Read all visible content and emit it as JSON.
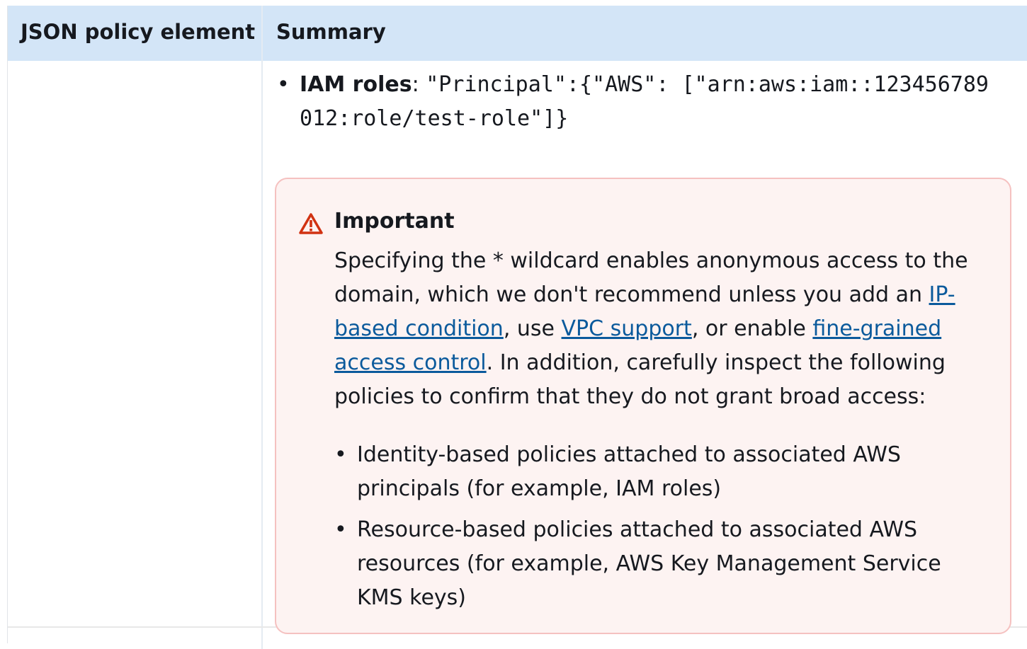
{
  "table": {
    "headers": [
      "JSON policy element",
      "Summary"
    ]
  },
  "bullet": {
    "label": "IAM roles",
    "separator": ": ",
    "code": "\"Principal\":{\"AWS\": [\"arn:aws:iam::123456789012:role/test-role\"]}"
  },
  "alert": {
    "title": "Important",
    "icon": "warning-triangle-icon",
    "text_1": "Specifying the * wildcard enables anonymous access to the domain, which we don't recommend unless you add an ",
    "link_1": "IP-based condition",
    "text_2": ", use ",
    "link_2": "VPC support",
    "text_3": ", or enable ",
    "link_3": "fine-grained access control",
    "text_4": ". In addition, carefully inspect the following policies to confirm that they do not grant broad access:",
    "items": [
      "Identity-based policies attached to associated AWS principals (for example, IAM roles)",
      "Resource-based policies attached to associated AWS resources (for example, AWS Key Management Service KMS keys)"
    ]
  },
  "colors": {
    "header_bg": "#d3e5f7",
    "alert_bg": "#fdf3f2",
    "alert_border": "#f5c1c0",
    "link": "#0b5a9c",
    "warning": "#d13212"
  }
}
